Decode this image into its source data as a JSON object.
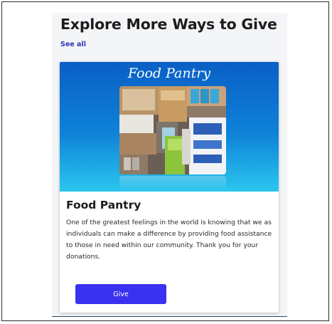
{
  "section": {
    "title": "Explore More Ways to Give",
    "see_all": "See all"
  },
  "card": {
    "banner_title": "Food Pantry",
    "title": "Food Pantry",
    "description": "One of the greatest feelings in the world is knowing that we as individuals can make a difference by providing food assistance to those in need within our community. Thank you for your donations.",
    "button_label": "Give"
  },
  "colors": {
    "accent": "#3a32f0",
    "link": "#2b36b8",
    "banner_top": "#0a5fc6",
    "banner_bottom": "#2bc7ee"
  }
}
